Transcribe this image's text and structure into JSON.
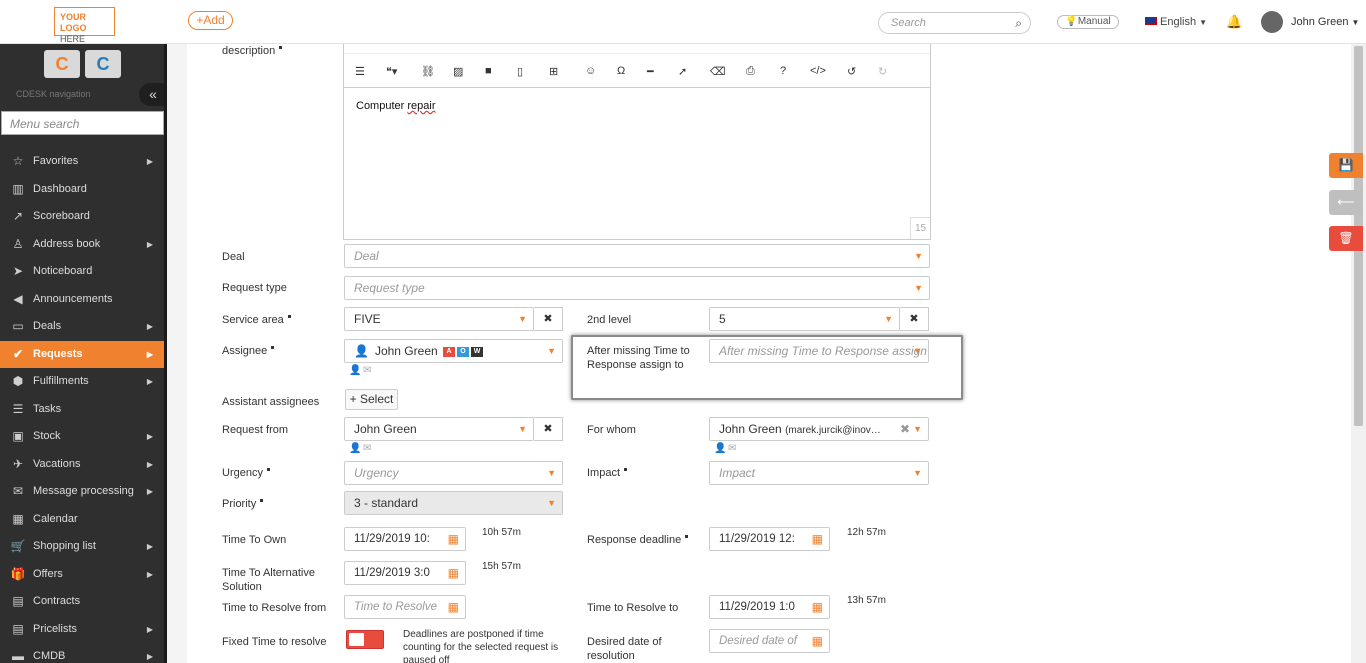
{
  "topbar": {
    "logo_line1": "YOUR LOGO",
    "logo_line2": "HERE",
    "add_label": "+Add",
    "search_placeholder": "Search",
    "manual_label": "Manual",
    "language": "English",
    "user_name": "John Green"
  },
  "sidebar": {
    "brand1": "C",
    "brand2": "C",
    "caption": "CDESK navigation",
    "search_placeholder": "Menu search",
    "items": [
      {
        "label": "Favorites",
        "icon": "star-icon",
        "glyph": "☆",
        "arrow": true
      },
      {
        "label": "Dashboard",
        "icon": "bar-chart-icon",
        "glyph": "▥",
        "arrow": false
      },
      {
        "label": "Scoreboard",
        "icon": "line-chart-icon",
        "glyph": "↗",
        "arrow": false
      },
      {
        "label": "Address book",
        "icon": "person-icon",
        "glyph": "♙",
        "arrow": true
      },
      {
        "label": "Noticeboard",
        "icon": "paper-plane-icon",
        "glyph": "➤",
        "arrow": false
      },
      {
        "label": "Announcements",
        "icon": "megaphone-icon",
        "glyph": "◀",
        "arrow": false
      },
      {
        "label": "Deals",
        "icon": "deals-icon",
        "glyph": "▭",
        "arrow": true
      },
      {
        "label": "Requests",
        "icon": "check-circle-icon",
        "glyph": "✔",
        "arrow": true,
        "active": true
      },
      {
        "label": "Fulfillments",
        "icon": "cube-icon",
        "glyph": "⬢",
        "arrow": true
      },
      {
        "label": "Tasks",
        "icon": "tasks-icon",
        "glyph": "☰",
        "arrow": false
      },
      {
        "label": "Stock",
        "icon": "box-icon",
        "glyph": "▣",
        "arrow": true
      },
      {
        "label": "Vacations",
        "icon": "plane-icon",
        "glyph": "✈",
        "arrow": true
      },
      {
        "label": "Message processing",
        "icon": "envelope-icon",
        "glyph": "✉",
        "arrow": true
      },
      {
        "label": "Calendar",
        "icon": "calendar-icon",
        "glyph": "▦",
        "arrow": false
      },
      {
        "label": "Shopping list",
        "icon": "cart-icon",
        "glyph": "🛒",
        "arrow": true
      },
      {
        "label": "Offers",
        "icon": "gift-icon",
        "glyph": "🎁",
        "arrow": true
      },
      {
        "label": "Contracts",
        "icon": "file-icon",
        "glyph": "▤",
        "arrow": false
      },
      {
        "label": "Pricelists",
        "icon": "pricelist-icon",
        "glyph": "▤",
        "arrow": true
      },
      {
        "label": "CMDB",
        "icon": "cmdb-icon",
        "glyph": "▬",
        "arrow": true
      }
    ]
  },
  "form": {
    "description_label": "description",
    "editor_text_plain": "Computer ",
    "editor_text_underlined": "repair",
    "editor_count": "15",
    "deal_label": "Deal",
    "deal_placeholder": "Deal",
    "request_type_label": "Request type",
    "request_type_placeholder": "Request type",
    "service_area_label": "Service area",
    "service_area_value": "FIVE",
    "second_level_label": "2nd level",
    "second_level_value": "5",
    "assignee_label": "Assignee",
    "assignee_value": "John Green",
    "assignee_badges": [
      "A",
      "O",
      "W"
    ],
    "after_missing_label": "After missing Time to Response assign to",
    "after_missing_placeholder": "After missing Time to Response assign to",
    "assistant_label": "Assistant assignees",
    "select_label": "+ Select",
    "request_from_label": "Request from",
    "request_from_value": "John Green",
    "for_whom_label": "For whom",
    "for_whom_value": "John Green",
    "for_whom_email": "(marek.jurcik@inov…",
    "urgency_label": "Urgency",
    "urgency_placeholder": "Urgency",
    "impact_label": "Impact",
    "impact_placeholder": "Impact",
    "priority_label": "Priority",
    "priority_value": "3 - standard",
    "time_to_own_label": "Time To Own",
    "time_to_own_value": "11/29/2019 10:",
    "time_to_own_dur": "10h 57m",
    "response_deadline_label": "Response deadline",
    "response_deadline_value": "11/29/2019 12:",
    "response_deadline_dur": "12h 57m",
    "alt_solution_label": "Time To Alternative Solution",
    "alt_solution_value": "11/29/2019 3:0",
    "alt_solution_dur": "15h 57m",
    "resolve_from_label": "Time to Resolve from",
    "resolve_from_placeholder": "Time to Resolve",
    "resolve_to_label": "Time to Resolve to",
    "resolve_to_value": "11/29/2019 1:0",
    "resolve_to_dur": "13h 57m",
    "fixed_time_label": "Fixed Time to resolve",
    "fixed_time_note": "Deadlines are postponed if time counting for the selected request is paused off",
    "desired_date_label": "Desired date of resolution",
    "desired_date_placeholder": "Desired date of"
  },
  "colors": {
    "accent": "#f0812e",
    "danger": "#e74c3c",
    "sidebar": "#2f2f2f"
  }
}
